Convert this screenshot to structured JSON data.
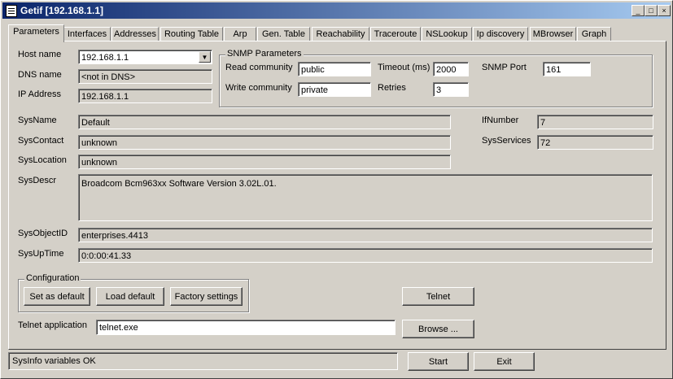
{
  "window": {
    "title": "Getif [192.168.1.1]",
    "min": "_",
    "max": "□",
    "close": "×"
  },
  "tabs": [
    "Parameters",
    "Interfaces",
    "Addresses",
    "Routing Table",
    "Arp",
    "Gen. Table",
    "Reachability",
    "Traceroute",
    "NSLookup",
    "Ip discovery",
    "MBrowser",
    "Graph"
  ],
  "host": {
    "label": "Host name",
    "value": "192.168.1.1"
  },
  "dns": {
    "label": "DNS name",
    "value": "<not in DNS>"
  },
  "ip": {
    "label": "IP Address",
    "value": "192.168.1.1"
  },
  "snmp": {
    "title": "SNMP Parameters",
    "read_label": "Read community",
    "read_value": "public",
    "write_label": "Write community",
    "write_value": "private",
    "timeout_label": "Timeout (ms)",
    "timeout_value": "2000",
    "retries_label": "Retries",
    "retries_value": "3",
    "port_label": "SNMP Port",
    "port_value": "161"
  },
  "sys": {
    "name_label": "SysName",
    "name": "Default",
    "contact_label": "SysContact",
    "contact": "unknown",
    "location_label": "SysLocation",
    "location": "unknown",
    "descr_label": "SysDescr",
    "descr": "Broadcom Bcm963xx Software Version 3.02L.01.",
    "oid_label": "SysObjectID",
    "oid": "enterprises.4413",
    "uptime_label": "SysUpTime",
    "uptime": "0:0:00:41.33",
    "ifnumber_label": "IfNumber",
    "ifnumber": "7",
    "services_label": "SysServices",
    "services": "72"
  },
  "config": {
    "title": "Configuration",
    "set_default": "Set as default",
    "load_default": "Load default",
    "factory": "Factory settings"
  },
  "telnet": {
    "button": "Telnet",
    "app_label": "Telnet application",
    "app_value": "telnet.exe",
    "browse": "Browse ..."
  },
  "status_text": "SysInfo variables OK",
  "start": "Start",
  "exit": "Exit"
}
